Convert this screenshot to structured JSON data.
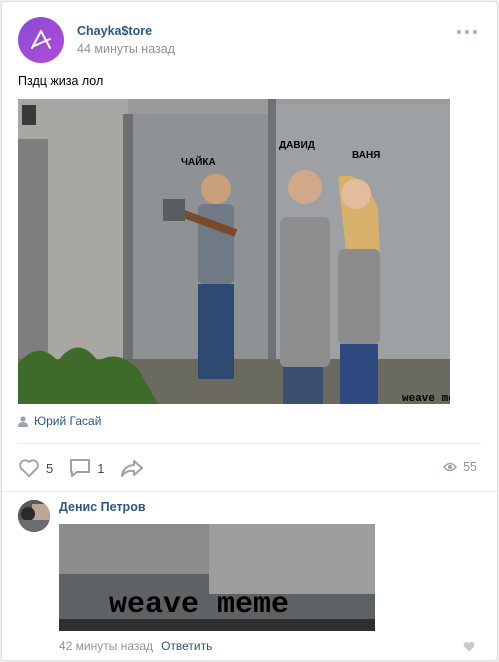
{
  "post": {
    "author": "Chayka$tore",
    "time": "44 минуты назад",
    "text": "Пздц жиза лол",
    "photo_labels": {
      "left": "ЧАЙКА",
      "middle": "ДАВИД",
      "right": "ВАНЯ",
      "watermark": "weave meme"
    },
    "signer": "Юрий Гасай",
    "likes": "5",
    "comments": "1",
    "views": "55"
  },
  "comment": {
    "author": "Денис Петров",
    "image_text": "weave meme",
    "time": "42 минуты назад",
    "reply_label": "Ответить"
  },
  "colors": {
    "link": "#2a5885",
    "muted": "#939393",
    "icon": "#99a2ad",
    "avatar_gradient": [
      "#8a4bd6",
      "#b04bd8"
    ]
  },
  "icons": [
    "more-icon",
    "user-icon",
    "heart-icon",
    "comment-icon",
    "share-icon",
    "eye-icon"
  ]
}
